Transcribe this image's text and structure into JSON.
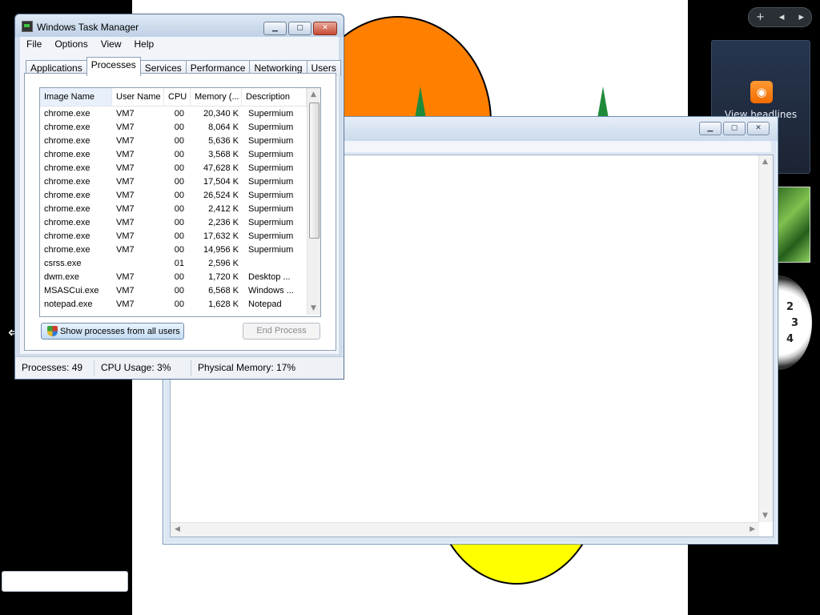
{
  "desktop": {
    "feed_gadget_label": "View headlines",
    "clock_numbers": [
      "2",
      "3",
      "4"
    ],
    "toolbar_add": "+",
    "toolbar_prev": "◂",
    "toolbar_next": "▸"
  },
  "notepad": {
    "minimize": "▁",
    "maximize": "▢",
    "close": "✕"
  },
  "task_manager": {
    "title": "Windows Task Manager",
    "controls": {
      "minimize": "▁",
      "maximize": "▢",
      "close": "✕"
    },
    "menu": [
      "File",
      "Options",
      "View",
      "Help"
    ],
    "tabs": [
      "Applications",
      "Processes",
      "Services",
      "Performance",
      "Networking",
      "Users"
    ],
    "active_tab": "Processes",
    "columns": [
      "Image Name",
      "User Name",
      "CPU",
      "Memory (...",
      "Description"
    ],
    "processes": [
      {
        "name": "chrome.exe",
        "user": "VM7",
        "cpu": "00",
        "mem": "20,340 K",
        "desc": "Supermium"
      },
      {
        "name": "chrome.exe",
        "user": "VM7",
        "cpu": "00",
        "mem": "8,064 K",
        "desc": "Supermium"
      },
      {
        "name": "chrome.exe",
        "user": "VM7",
        "cpu": "00",
        "mem": "5,636 K",
        "desc": "Supermium"
      },
      {
        "name": "chrome.exe",
        "user": "VM7",
        "cpu": "00",
        "mem": "3,568 K",
        "desc": "Supermium"
      },
      {
        "name": "chrome.exe",
        "user": "VM7",
        "cpu": "00",
        "mem": "47,628 K",
        "desc": "Supermium"
      },
      {
        "name": "chrome.exe",
        "user": "VM7",
        "cpu": "00",
        "mem": "17,504 K",
        "desc": "Supermium"
      },
      {
        "name": "chrome.exe",
        "user": "VM7",
        "cpu": "00",
        "mem": "26,524 K",
        "desc": "Supermium"
      },
      {
        "name": "chrome.exe",
        "user": "VM7",
        "cpu": "00",
        "mem": "2,412 K",
        "desc": "Supermium"
      },
      {
        "name": "chrome.exe",
        "user": "VM7",
        "cpu": "00",
        "mem": "2,236 K",
        "desc": "Supermium"
      },
      {
        "name": "chrome.exe",
        "user": "VM7",
        "cpu": "00",
        "mem": "17,632 K",
        "desc": "Supermium"
      },
      {
        "name": "chrome.exe",
        "user": "VM7",
        "cpu": "00",
        "mem": "14,956 K",
        "desc": "Supermium"
      },
      {
        "name": "csrss.exe",
        "user": "",
        "cpu": "01",
        "mem": "2,596 K",
        "desc": ""
      },
      {
        "name": "dwm.exe",
        "user": "VM7",
        "cpu": "00",
        "mem": "1,720 K",
        "desc": "Desktop ..."
      },
      {
        "name": "MSASCui.exe",
        "user": "VM7",
        "cpu": "00",
        "mem": "6,568 K",
        "desc": "Windows ..."
      },
      {
        "name": "notepad.exe",
        "user": "VM7",
        "cpu": "00",
        "mem": "1,628 K",
        "desc": "Notepad"
      }
    ],
    "show_all_button": "Show processes from all users",
    "end_process_button": "End Process",
    "status": {
      "processes": "Processes: 49",
      "cpu": "CPU Usage: 3%",
      "memory": "Physical Memory: 17%"
    }
  }
}
